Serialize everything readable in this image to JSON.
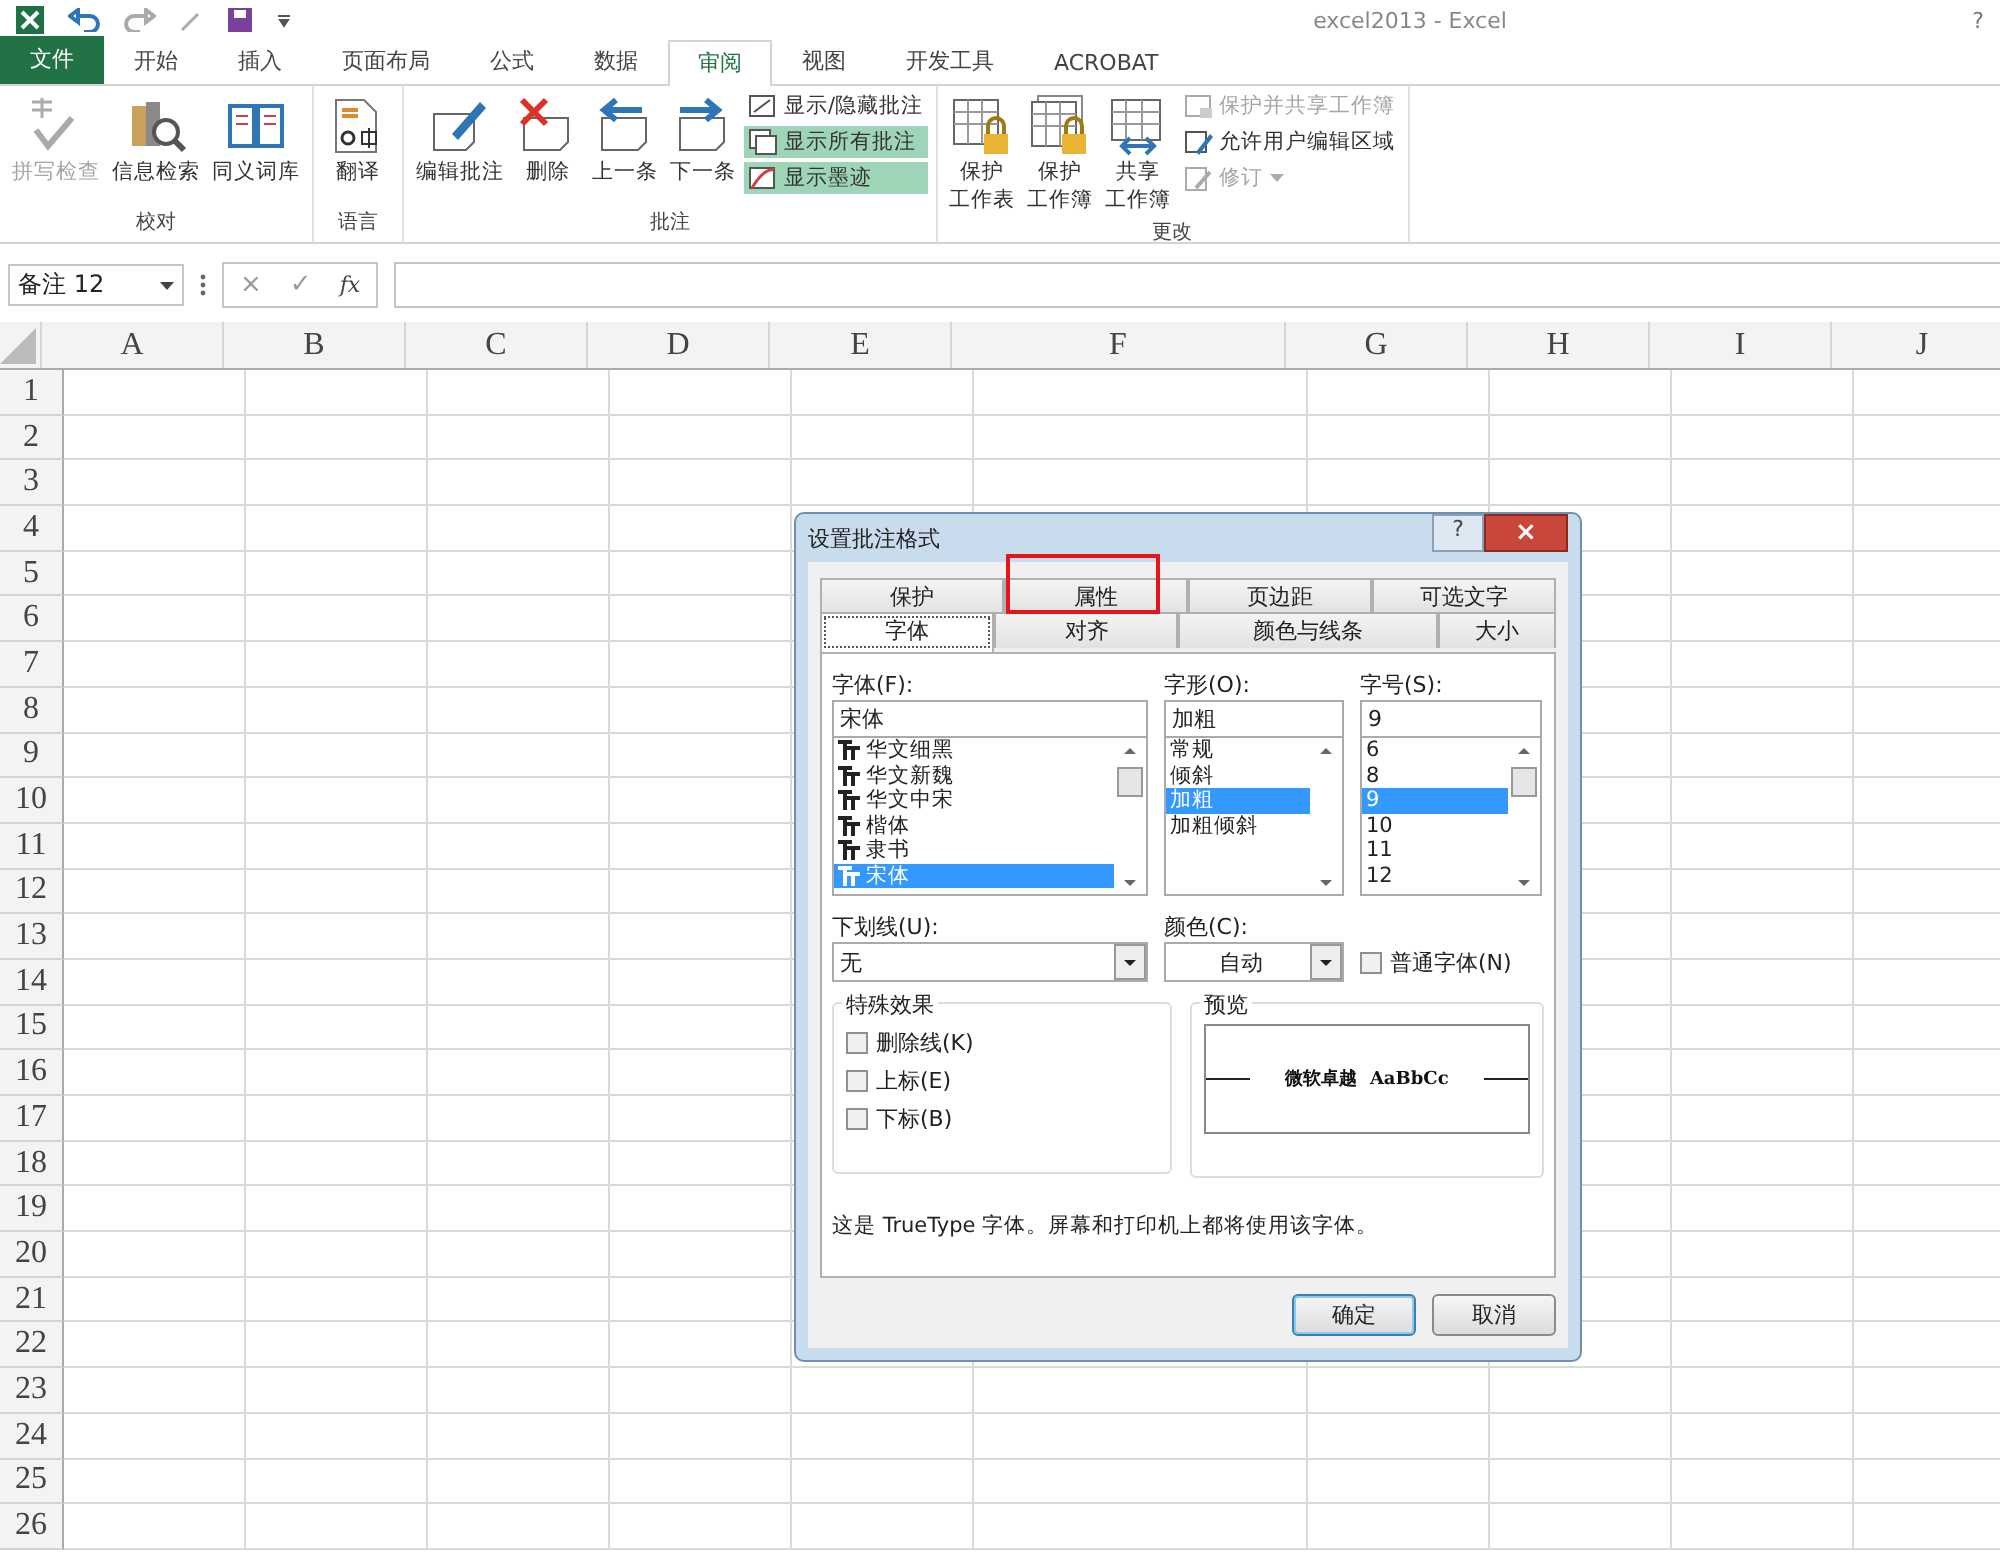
{
  "window": {
    "title": "excel2013 - Excel",
    "help": "?"
  },
  "ribbon_tabs": [
    {
      "label": "文件",
      "kind": "file",
      "selected": false
    },
    {
      "label": "开始",
      "kind": "tab",
      "selected": false
    },
    {
      "label": "插入",
      "kind": "tab",
      "selected": false
    },
    {
      "label": "页面布局",
      "kind": "tab",
      "selected": false
    },
    {
      "label": "公式",
      "kind": "tab",
      "selected": false
    },
    {
      "label": "数据",
      "kind": "tab",
      "selected": false
    },
    {
      "label": "审阅",
      "kind": "tab",
      "selected": true
    },
    {
      "label": "视图",
      "kind": "tab",
      "selected": false
    },
    {
      "label": "开发工具",
      "kind": "tab",
      "selected": false
    },
    {
      "label": "ACROBAT",
      "kind": "tab",
      "selected": false
    }
  ],
  "ribbon_groups": [
    {
      "title": "校对",
      "buttons": [
        {
          "label": "拼写检查",
          "disabled": true
        },
        {
          "label": "信息检索",
          "disabled": false
        },
        {
          "label": "同义词库",
          "disabled": false
        }
      ]
    },
    {
      "title": "语言",
      "buttons": [
        {
          "label": "翻译",
          "disabled": false
        }
      ]
    },
    {
      "title": "批注",
      "buttons": [
        {
          "label": "编辑批注",
          "disabled": false
        },
        {
          "label": "删除",
          "disabled": false
        },
        {
          "label": "上一条",
          "disabled": false
        },
        {
          "label": "下一条",
          "disabled": false
        }
      ],
      "small_buttons": [
        {
          "label": "显示/隐藏批注",
          "on": false,
          "disabled": false,
          "dropdown": false
        },
        {
          "label": "显示所有批注",
          "on": true,
          "disabled": false,
          "dropdown": false
        },
        {
          "label": "显示墨迹",
          "on": true,
          "disabled": false,
          "dropdown": false
        }
      ]
    },
    {
      "title": "更改",
      "buttons": [
        {
          "lines": [
            "保护",
            "工作表"
          ],
          "disabled": false
        },
        {
          "lines": [
            "保护",
            "工作簿"
          ],
          "disabled": false
        },
        {
          "lines": [
            "共享",
            "工作簿"
          ],
          "disabled": false
        }
      ],
      "small_buttons": [
        {
          "label": "保护并共享工作簿",
          "on": false,
          "disabled": true,
          "dropdown": false
        },
        {
          "label": "允许用户编辑区域",
          "on": false,
          "disabled": false,
          "dropdown": false
        },
        {
          "label": "修订",
          "on": false,
          "disabled": true,
          "dropdown": true
        }
      ]
    }
  ],
  "formula_bar": {
    "name_box": "备注 12",
    "cancel": "×",
    "enter": "✓",
    "function": "fx"
  },
  "sheet": {
    "columns": [
      "A",
      "B",
      "C",
      "D",
      "E",
      "F",
      "G",
      "H",
      "I",
      "J"
    ],
    "rows": [
      "1",
      "2",
      "3",
      "4",
      "5",
      "6",
      "7",
      "8",
      "9",
      "10",
      "11",
      "12",
      "13",
      "14",
      "15",
      "16",
      "17",
      "18",
      "19",
      "20",
      "21",
      "22",
      "23",
      "24",
      "25",
      "26"
    ]
  },
  "dialog": {
    "title": "设置批注格式",
    "help": "?",
    "close": "×",
    "back_tabs": [
      {
        "label": "保护",
        "selected": false
      },
      {
        "label": "属性",
        "selected": false
      },
      {
        "label": "页边距",
        "selected": false
      },
      {
        "label": "可选文字",
        "selected": false
      }
    ],
    "front_tabs": [
      {
        "label": "字体",
        "selected": true
      },
      {
        "label": "对齐",
        "selected": false
      },
      {
        "label": "颜色与线条",
        "selected": false
      },
      {
        "label": "大小",
        "selected": false
      }
    ],
    "font": {
      "label": "字体(F):",
      "value": "宋体",
      "items": [
        {
          "label": "华文细黑",
          "selected": false
        },
        {
          "label": "华文新魏",
          "selected": false
        },
        {
          "label": "华文中宋",
          "selected": false
        },
        {
          "label": "楷体",
          "selected": false
        },
        {
          "label": "隶书",
          "selected": false
        },
        {
          "label": "宋体",
          "selected": true
        }
      ]
    },
    "style": {
      "label": "字形(O):",
      "value": "加粗",
      "items": [
        {
          "label": "常规",
          "selected": false
        },
        {
          "label": "倾斜",
          "selected": false
        },
        {
          "label": "加粗",
          "selected": true
        },
        {
          "label": "加粗倾斜",
          "selected": false
        }
      ]
    },
    "size": {
      "label": "字号(S):",
      "value": "9",
      "items": [
        {
          "label": "6",
          "selected": false
        },
        {
          "label": "8",
          "selected": false
        },
        {
          "label": "9",
          "selected": true
        },
        {
          "label": "10",
          "selected": false
        },
        {
          "label": "11",
          "selected": false
        },
        {
          "label": "12",
          "selected": false
        }
      ]
    },
    "underline": {
      "label": "下划线(U):",
      "value": "无"
    },
    "color": {
      "label": "颜色(C):",
      "value": "自动"
    },
    "normal_font": {
      "label": "普通字体(N)",
      "checked": false
    },
    "effects": {
      "title": "特殊效果",
      "items": [
        {
          "label": "删除线(K)",
          "checked": false
        },
        {
          "label": "上标(E)",
          "checked": false
        },
        {
          "label": "下标(B)",
          "checked": false
        }
      ]
    },
    "preview": {
      "title": "预览",
      "sample": "微软卓越  AaBbCc"
    },
    "note": "这是 TrueType 字体。屏幕和打印机上都将使用该字体。",
    "buttons": [
      {
        "label": "确定",
        "default": true
      },
      {
        "label": "取消",
        "default": false
      }
    ]
  }
}
